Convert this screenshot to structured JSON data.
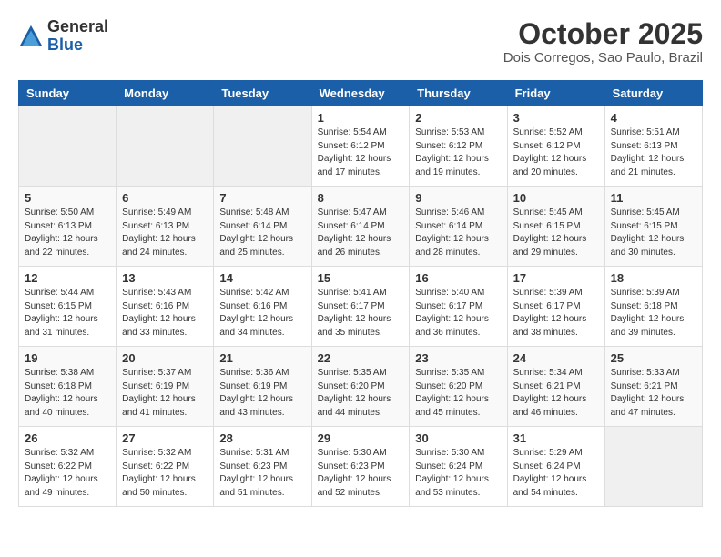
{
  "header": {
    "logo": {
      "general": "General",
      "blue": "Blue"
    },
    "title": "October 2025",
    "location": "Dois Corregos, Sao Paulo, Brazil"
  },
  "weekdays": [
    "Sunday",
    "Monday",
    "Tuesday",
    "Wednesday",
    "Thursday",
    "Friday",
    "Saturday"
  ],
  "weeks": [
    [
      {
        "day": "",
        "info": ""
      },
      {
        "day": "",
        "info": ""
      },
      {
        "day": "",
        "info": ""
      },
      {
        "day": "1",
        "info": "Sunrise: 5:54 AM\nSunset: 6:12 PM\nDaylight: 12 hours\nand 17 minutes."
      },
      {
        "day": "2",
        "info": "Sunrise: 5:53 AM\nSunset: 6:12 PM\nDaylight: 12 hours\nand 19 minutes."
      },
      {
        "day": "3",
        "info": "Sunrise: 5:52 AM\nSunset: 6:12 PM\nDaylight: 12 hours\nand 20 minutes."
      },
      {
        "day": "4",
        "info": "Sunrise: 5:51 AM\nSunset: 6:13 PM\nDaylight: 12 hours\nand 21 minutes."
      }
    ],
    [
      {
        "day": "5",
        "info": "Sunrise: 5:50 AM\nSunset: 6:13 PM\nDaylight: 12 hours\nand 22 minutes."
      },
      {
        "day": "6",
        "info": "Sunrise: 5:49 AM\nSunset: 6:13 PM\nDaylight: 12 hours\nand 24 minutes."
      },
      {
        "day": "7",
        "info": "Sunrise: 5:48 AM\nSunset: 6:14 PM\nDaylight: 12 hours\nand 25 minutes."
      },
      {
        "day": "8",
        "info": "Sunrise: 5:47 AM\nSunset: 6:14 PM\nDaylight: 12 hours\nand 26 minutes."
      },
      {
        "day": "9",
        "info": "Sunrise: 5:46 AM\nSunset: 6:14 PM\nDaylight: 12 hours\nand 28 minutes."
      },
      {
        "day": "10",
        "info": "Sunrise: 5:45 AM\nSunset: 6:15 PM\nDaylight: 12 hours\nand 29 minutes."
      },
      {
        "day": "11",
        "info": "Sunrise: 5:45 AM\nSunset: 6:15 PM\nDaylight: 12 hours\nand 30 minutes."
      }
    ],
    [
      {
        "day": "12",
        "info": "Sunrise: 5:44 AM\nSunset: 6:15 PM\nDaylight: 12 hours\nand 31 minutes."
      },
      {
        "day": "13",
        "info": "Sunrise: 5:43 AM\nSunset: 6:16 PM\nDaylight: 12 hours\nand 33 minutes."
      },
      {
        "day": "14",
        "info": "Sunrise: 5:42 AM\nSunset: 6:16 PM\nDaylight: 12 hours\nand 34 minutes."
      },
      {
        "day": "15",
        "info": "Sunrise: 5:41 AM\nSunset: 6:17 PM\nDaylight: 12 hours\nand 35 minutes."
      },
      {
        "day": "16",
        "info": "Sunrise: 5:40 AM\nSunset: 6:17 PM\nDaylight: 12 hours\nand 36 minutes."
      },
      {
        "day": "17",
        "info": "Sunrise: 5:39 AM\nSunset: 6:17 PM\nDaylight: 12 hours\nand 38 minutes."
      },
      {
        "day": "18",
        "info": "Sunrise: 5:39 AM\nSunset: 6:18 PM\nDaylight: 12 hours\nand 39 minutes."
      }
    ],
    [
      {
        "day": "19",
        "info": "Sunrise: 5:38 AM\nSunset: 6:18 PM\nDaylight: 12 hours\nand 40 minutes."
      },
      {
        "day": "20",
        "info": "Sunrise: 5:37 AM\nSunset: 6:19 PM\nDaylight: 12 hours\nand 41 minutes."
      },
      {
        "day": "21",
        "info": "Sunrise: 5:36 AM\nSunset: 6:19 PM\nDaylight: 12 hours\nand 43 minutes."
      },
      {
        "day": "22",
        "info": "Sunrise: 5:35 AM\nSunset: 6:20 PM\nDaylight: 12 hours\nand 44 minutes."
      },
      {
        "day": "23",
        "info": "Sunrise: 5:35 AM\nSunset: 6:20 PM\nDaylight: 12 hours\nand 45 minutes."
      },
      {
        "day": "24",
        "info": "Sunrise: 5:34 AM\nSunset: 6:21 PM\nDaylight: 12 hours\nand 46 minutes."
      },
      {
        "day": "25",
        "info": "Sunrise: 5:33 AM\nSunset: 6:21 PM\nDaylight: 12 hours\nand 47 minutes."
      }
    ],
    [
      {
        "day": "26",
        "info": "Sunrise: 5:32 AM\nSunset: 6:22 PM\nDaylight: 12 hours\nand 49 minutes."
      },
      {
        "day": "27",
        "info": "Sunrise: 5:32 AM\nSunset: 6:22 PM\nDaylight: 12 hours\nand 50 minutes."
      },
      {
        "day": "28",
        "info": "Sunrise: 5:31 AM\nSunset: 6:23 PM\nDaylight: 12 hours\nand 51 minutes."
      },
      {
        "day": "29",
        "info": "Sunrise: 5:30 AM\nSunset: 6:23 PM\nDaylight: 12 hours\nand 52 minutes."
      },
      {
        "day": "30",
        "info": "Sunrise: 5:30 AM\nSunset: 6:24 PM\nDaylight: 12 hours\nand 53 minutes."
      },
      {
        "day": "31",
        "info": "Sunrise: 5:29 AM\nSunset: 6:24 PM\nDaylight: 12 hours\nand 54 minutes."
      },
      {
        "day": "",
        "info": ""
      }
    ]
  ]
}
